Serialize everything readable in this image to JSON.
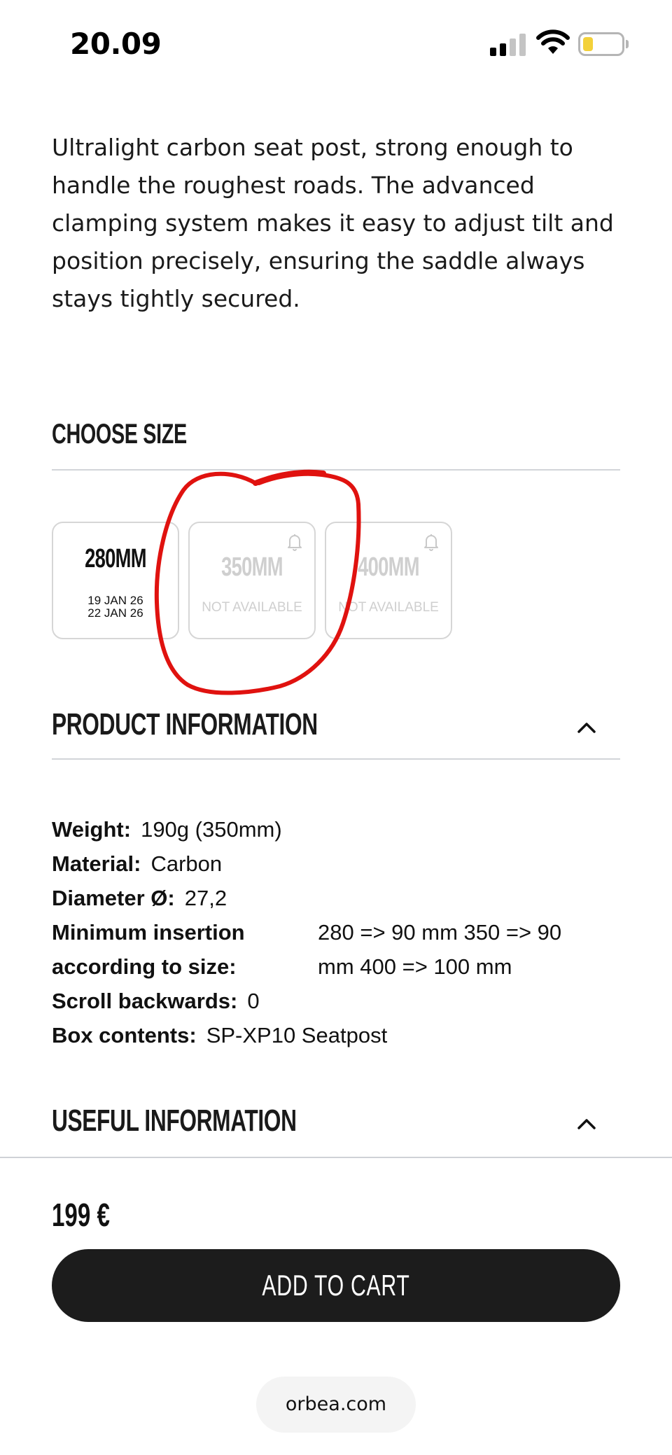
{
  "status_bar": {
    "time": "20.09",
    "battery_color": "#f3d13a"
  },
  "description": "Ultralight carbon seat post, strong enough to handle the roughest roads. The advanced clamping system makes it easy to adjust tilt and position precisely, ensuring the saddle always stays tightly secured.",
  "choose_size": {
    "title": "CHOOSE SIZE",
    "options": [
      {
        "label": "280MM",
        "available": true,
        "dates": [
          "19 JAN 26",
          "22 JAN 26"
        ]
      },
      {
        "label": "350MM",
        "available": false,
        "status": "NOT AVAILABLE",
        "icon": "bell-icon"
      },
      {
        "label": "400MM",
        "available": false,
        "status": "NOT AVAILABLE",
        "icon": "bell-icon"
      }
    ]
  },
  "annotation": {
    "shape": "hand-drawn circle",
    "color": "#e0120f"
  },
  "product_information": {
    "title": "PRODUCT INFORMATION",
    "specs": [
      {
        "label": "Weight:",
        "value": "190g (350mm)"
      },
      {
        "label": "Material:",
        "value": "Carbon"
      },
      {
        "label": "Diameter Ø:",
        "value": "27,2"
      },
      {
        "label": "Minimum insertion according to size:",
        "value": "280 => 90 mm 350 => 90 mm 400 => 100 mm"
      },
      {
        "label": "Scroll backwards:",
        "value": "0"
      },
      {
        "label": "Box contents:",
        "value": "SP-XP10 Seatpost"
      }
    ]
  },
  "useful_information": {
    "title": "USEFUL INFORMATION"
  },
  "purchase": {
    "price": "199 €",
    "cart_label": "ADD TO CART",
    "button_color": "#1c1c1c"
  },
  "browser": {
    "url": "orbea.com"
  }
}
